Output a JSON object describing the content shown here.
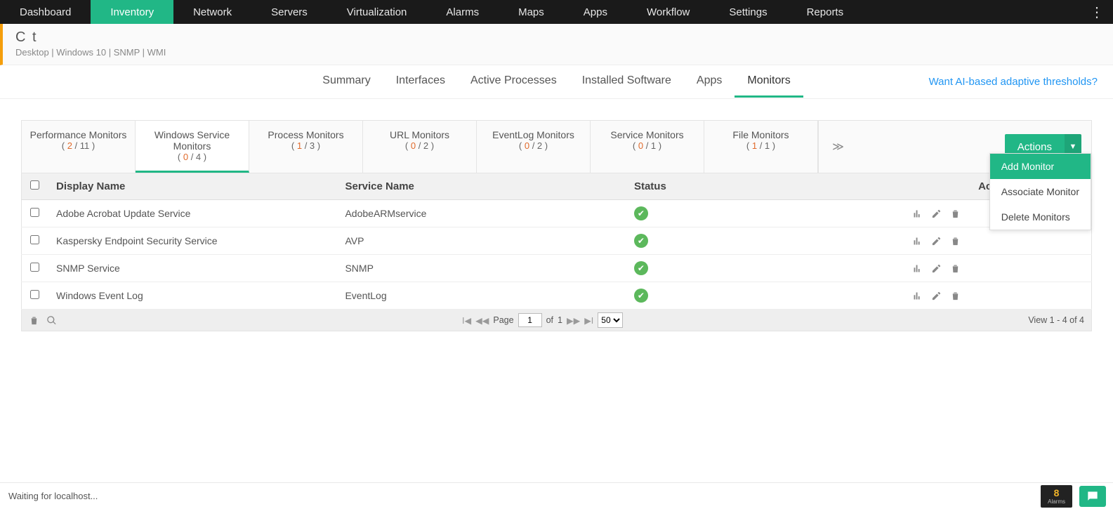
{
  "topnav": [
    "Dashboard",
    "Inventory",
    "Network",
    "Servers",
    "Virtualization",
    "Alarms",
    "Maps",
    "Apps",
    "Workflow",
    "Settings",
    "Reports"
  ],
  "topnav_active": 1,
  "device": {
    "title": "C                                   t",
    "meta": "Desktop | Windows 10  | SNMP  | WMI"
  },
  "subnav": {
    "tabs": [
      "Summary",
      "Interfaces",
      "Active Processes",
      "Installed Software",
      "Apps",
      "Monitors"
    ],
    "active": 5,
    "rightlink": "Want AI-based adaptive thresholds?"
  },
  "monitor_tabs": [
    {
      "label": "Performance Monitors",
      "down": "2",
      "total": "11"
    },
    {
      "label": "Windows Service Monitors",
      "down": "0",
      "total": "4"
    },
    {
      "label": "Process Monitors",
      "down": "1",
      "total": "3"
    },
    {
      "label": "URL Monitors",
      "down": "0",
      "total": "2"
    },
    {
      "label": "EventLog Monitors",
      "down": "0",
      "total": "2"
    },
    {
      "label": "Service Monitors",
      "down": "0",
      "total": "1"
    },
    {
      "label": "File Monitors",
      "down": "1",
      "total": "1"
    }
  ],
  "monitor_tabs_active": 1,
  "actions_button": "Actions",
  "actions_menu": [
    "Add Monitor",
    "Associate Monitor",
    "Delete Monitors"
  ],
  "actions_menu_active": 0,
  "table": {
    "headers": [
      "Display Name",
      "Service Name",
      "Status",
      "Actions"
    ],
    "rows": [
      {
        "display": "Adobe Acrobat Update Service",
        "service": "AdobeARMservice"
      },
      {
        "display": "Kaspersky Endpoint Security Service",
        "service": "AVP"
      },
      {
        "display": "SNMP Service",
        "service": "SNMP"
      },
      {
        "display": "Windows Event Log",
        "service": "EventLog"
      }
    ]
  },
  "pager": {
    "page_label": "Page",
    "page": "1",
    "of_label": "of",
    "total_pages": "1",
    "page_size": "50",
    "view_text": "View 1 - 4 of 4"
  },
  "status_bar": "Waiting for localhost...",
  "alarm_count": "8",
  "alarm_label": "Alarms"
}
